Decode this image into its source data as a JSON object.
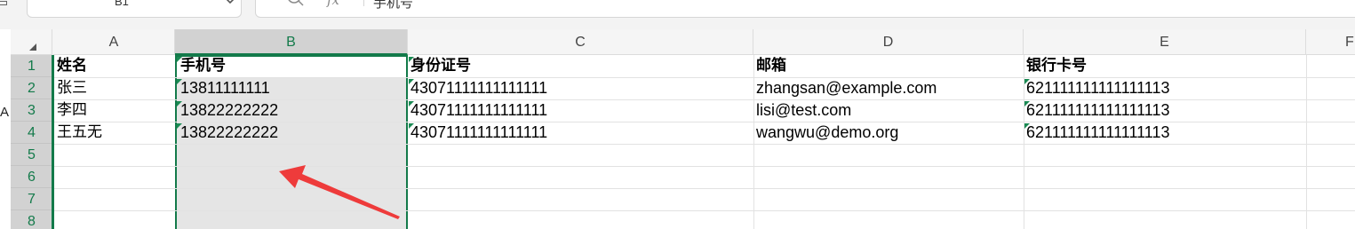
{
  "formula_bar": {
    "name_box": "B1",
    "fx_label": "fx",
    "content": "手机号"
  },
  "left_stray_char": "A",
  "sheet": {
    "columns": [
      "A",
      "B",
      "C",
      "D",
      "E",
      "F"
    ],
    "selected_column": "B",
    "rows": [
      "1",
      "2",
      "3",
      "4",
      "5",
      "6",
      "7",
      "8"
    ],
    "cells": {
      "r1": {
        "a": "姓名",
        "b": "手机号",
        "c": "身份证号",
        "d": "邮箱",
        "e": "银行卡号"
      },
      "r2": {
        "a": "张三",
        "b": "13811111111",
        "c": "43071111111111111",
        "d": "zhangsan@example.com",
        "e": "621111111111111113"
      },
      "r3": {
        "a": "李四",
        "b": "13822222222",
        "c": "43071111111111111",
        "d": "lisi@test.com",
        "e": "621111111111111113"
      },
      "r4": {
        "a": "王五无",
        "b": "13822222222",
        "c": "43071111111111111",
        "d": "wangwu@demo.org",
        "e": "621111111111111113"
      }
    }
  },
  "colors": {
    "accent_green": "#137a4a",
    "arrow_red": "#ee3b3b",
    "selected_bg": "#e5e5e5"
  },
  "icons": {
    "zoom": "zoom-out-icon",
    "chevron": "chevron-down-icon",
    "corner": "select-all-triangle-icon",
    "annotation": "red-arrow-annotation"
  }
}
